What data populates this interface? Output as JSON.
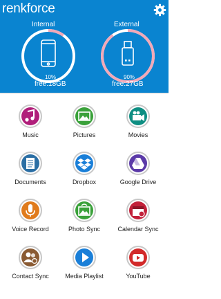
{
  "app": {
    "brand": "renkforce"
  },
  "storage": {
    "internal": {
      "label": "Internal",
      "percent_text": "10%",
      "free_text": "free:18GB",
      "used_fraction": 0.1
    },
    "external": {
      "label": "External",
      "percent_text": "90%",
      "free_text": "free:27GB",
      "used_fraction": 0.9
    }
  },
  "colors": {
    "header": "#0a84d0",
    "ring": "#ffffff",
    "ring_used": "#f2a9b8"
  },
  "apps": [
    {
      "label": "Music",
      "icon": "music-note-icon",
      "color": "#b01e7a"
    },
    {
      "label": "Pictures",
      "icon": "picture-icon",
      "color": "#3aa13a"
    },
    {
      "label": "Movies",
      "icon": "video-camera-icon",
      "color": "#0e8e82"
    },
    {
      "label": "Documents",
      "icon": "document-icon",
      "color": "#2a6ea4"
    },
    {
      "label": "Dropbox",
      "icon": "dropbox-icon",
      "color": "#1a7fd8"
    },
    {
      "label": "Google Drive",
      "icon": "google-drive-icon",
      "color": "#5b3aa8"
    },
    {
      "label": "Voice Record",
      "icon": "microphone-icon",
      "color": "#e07b1c"
    },
    {
      "label": "Photo Sync",
      "icon": "photo-sync-icon",
      "color": "#3aa13a"
    },
    {
      "label": "Calendar Sync",
      "icon": "calendar-sync-icon",
      "color": "#c2213a"
    },
    {
      "label": "Contact Sync",
      "icon": "contact-sync-icon",
      "color": "#8a5a32"
    },
    {
      "label": "Media Playlist",
      "icon": "play-icon",
      "color": "#1a7fd8"
    },
    {
      "label": "YouTube",
      "icon": "youtube-icon",
      "color": "#d22a2a"
    }
  ]
}
